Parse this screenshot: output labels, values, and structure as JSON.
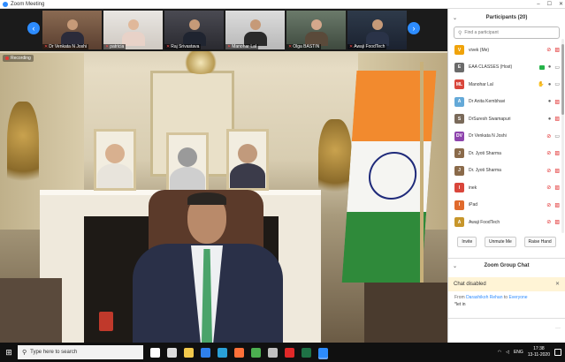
{
  "window": {
    "title": "Zoom Meeting",
    "controls": [
      "–",
      "☐",
      "✕"
    ]
  },
  "recording": {
    "label": "Recording"
  },
  "gallery": {
    "prev_arrow": "‹",
    "next_arrow": "›",
    "thumbs": [
      {
        "name": "Dr Venkata N Joshi",
        "mic_muted": true
      },
      {
        "name": "patricia",
        "mic_muted": true
      },
      {
        "name": "Raj Srivastava",
        "mic_muted": true
      },
      {
        "name": "Manohar Lal",
        "mic_muted": true
      },
      {
        "name": "Olga BASTIN",
        "mic_muted": true
      },
      {
        "name": "Awaji FoodTech",
        "mic_muted": true
      }
    ]
  },
  "participants": {
    "header": "Participants (20)",
    "collapse_icon": "⌄",
    "search_placeholder": "Find a participant",
    "list": [
      {
        "initials": "V",
        "color": "#f0a30a",
        "name": "vivek (Me)",
        "mic": "off",
        "cam": "off",
        "share": false,
        "hand": false
      },
      {
        "initials": "E",
        "color": "#6b6b6b",
        "name": "EAA CLASSES (Host)",
        "mic": "on",
        "cam": "on",
        "share": true,
        "hand": false
      },
      {
        "initials": "ML",
        "color": "#d9463b",
        "name": "Manohar Lal",
        "mic": "on",
        "cam": "on",
        "share": false,
        "hand": true
      },
      {
        "initials": "A",
        "color": "#64a9d8",
        "name": "Dr Anita Kembhavi",
        "mic": "on",
        "cam": "off",
        "share": false,
        "hand": false
      },
      {
        "initials": "S",
        "color": "#7a6a5a",
        "name": "DrSuresh Swamapuri",
        "mic": "on",
        "cam": "off",
        "share": false,
        "hand": false
      },
      {
        "initials": "DV",
        "color": "#8e44ad",
        "name": "Dr Venkata N Joshi",
        "mic": "off",
        "cam": "on",
        "share": false,
        "hand": false
      },
      {
        "initials": "J",
        "color": "#8a6a4a",
        "name": "Dr. Jyoti Sharma",
        "mic": "off",
        "cam": "off",
        "share": false,
        "hand": false
      },
      {
        "initials": "J",
        "color": "#8a6a4a",
        "name": "Dr. Jyoti Sharma",
        "mic": "off",
        "cam": "off",
        "share": false,
        "hand": false
      },
      {
        "initials": "I",
        "color": "#d9463b",
        "name": "inek",
        "mic": "off",
        "cam": "off",
        "share": false,
        "hand": false
      },
      {
        "initials": "I",
        "color": "#e06a2c",
        "name": "iPad",
        "mic": "off",
        "cam": "off",
        "share": false,
        "hand": false
      },
      {
        "initials": "A",
        "color": "#c7962b",
        "name": "Awaji FoodTech",
        "mic": "off",
        "cam": "off",
        "share": false,
        "hand": false
      }
    ],
    "buttons": {
      "invite": "Invite",
      "unmute_me": "Unmute Me",
      "raise_hand": "Raise Hand"
    }
  },
  "chat": {
    "header": "Zoom Group Chat",
    "disabled_text": "Chat disabled",
    "close_icon": "✕",
    "message": {
      "from_label": "From",
      "sender": "Darashikoh Rehan",
      "to_label": "to",
      "recipient": "Everyone",
      "text": "*let in"
    },
    "more_icon": "···"
  },
  "taskbar": {
    "search_placeholder": "Type here to search",
    "apps": [
      {
        "name": "cortana",
        "color": "#ffffff"
      },
      {
        "name": "task-view",
        "color": "#dddddd"
      },
      {
        "name": "file-explorer",
        "color": "#f2c94c"
      },
      {
        "name": "mail",
        "color": "#2f80ed"
      },
      {
        "name": "edge",
        "color": "#2aa1d8"
      },
      {
        "name": "firefox",
        "color": "#ff7139"
      },
      {
        "name": "chrome",
        "color": "#4caf50"
      },
      {
        "name": "winamp",
        "color": "#c0c0c0"
      },
      {
        "name": "opera",
        "color": "#e02828"
      },
      {
        "name": "excel",
        "color": "#1e7145"
      },
      {
        "name": "zoom",
        "color": "#2d8cff",
        "active": true
      }
    ],
    "tray": {
      "lang": "ENG",
      "time": "17:38",
      "date": "13-11-2020"
    }
  },
  "colors": {
    "accent": "#2d8cff",
    "muted": "#e02828",
    "chat_banner": "#fff4d6"
  }
}
